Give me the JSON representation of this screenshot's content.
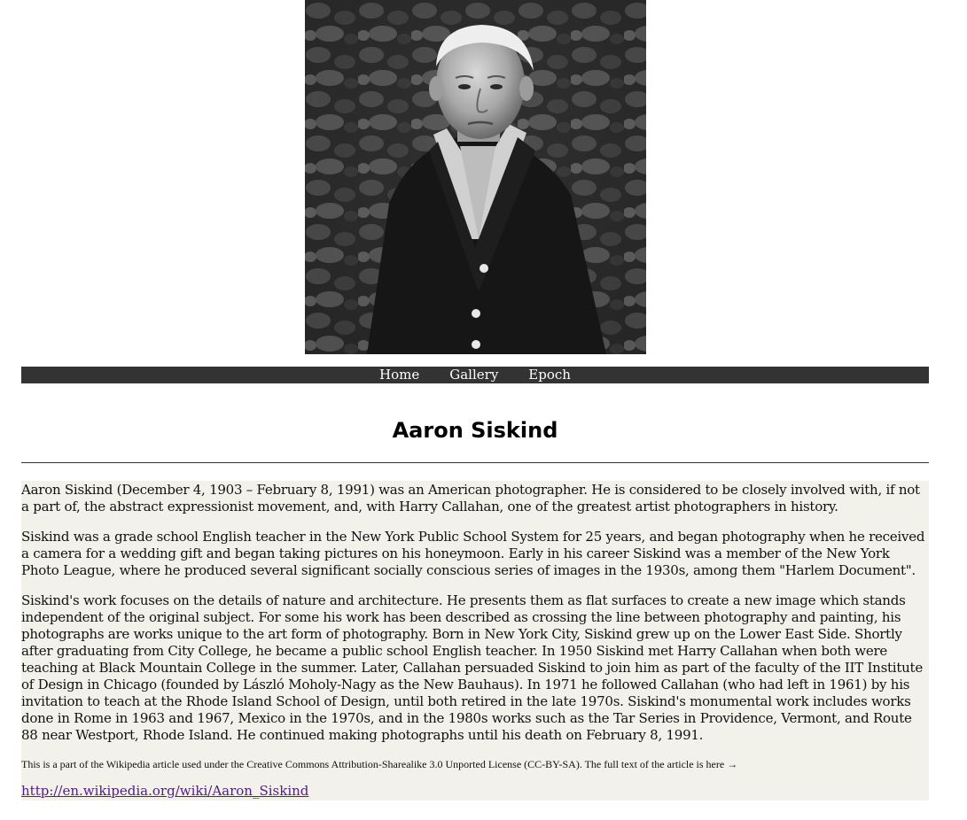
{
  "portrait": {
    "alt": "Aaron Siskind portrait"
  },
  "nav": {
    "items": [
      {
        "label": "Home"
      },
      {
        "label": "Gallery"
      },
      {
        "label": "Epoch"
      }
    ]
  },
  "page": {
    "title": "Aaron Siskind"
  },
  "article": {
    "paragraphs": [
      "Aaron Siskind (December 4, 1903 – February 8, 1991) was an American photographer. He is considered to be closely involved with, if not a part of, the abstract expressionist movement, and, with Harry Callahan, one of the greatest artist photographers in history.",
      "Siskind was a grade school English teacher in the New York Public School System for 25 years, and began photography when he received a camera for a wedding gift and began taking pictures on his honeymoon. Early in his career Siskind was a member of the New York Photo League, where he produced several significant socially conscious series of images in the 1930s, among them \"Harlem Document\".",
      "Siskind's work focuses on the details of nature and architecture. He presents them as flat surfaces to create a new image which stands independent of the original subject. For some his work has been described as crossing the line between photography and painting, his photographs are works unique to the art form of photography. Born in New York City, Siskind grew up on the Lower East Side. Shortly after graduating from City College, he became a public school English teacher. In 1950 Siskind met Harry Callahan when both were teaching at Black Mountain College in the summer. Later, Callahan persuaded Siskind to join him as part of the faculty of the IIT Institute of Design in Chicago (founded by László Moholy-Nagy as the New Bauhaus). In 1971 he followed Callahan (who had left in 1961) by his invitation to teach at the Rhode Island School of Design, until both retired in the late 1970s. Siskind's monumental work includes works done in Rome in 1963 and 1967, Mexico in the 1970s, and in the 1980s works such as the Tar Series in Providence, Vermont, and Route 88 near Westport, Rhode Island. He continued making photographs until his death on February 8, 1991."
    ],
    "license": "This is a part of the Wikipedia article used under the Creative Commons Attribution-Sharealike 3.0 Unported License (CC-BY-SA). The full text of the article is here →",
    "link": "http://en.wikipedia.org/wiki/Aaron_Siskind"
  },
  "colors": {
    "nav_background": "#333333",
    "article_background": "#f2f2ea",
    "link": "#551a8b"
  }
}
